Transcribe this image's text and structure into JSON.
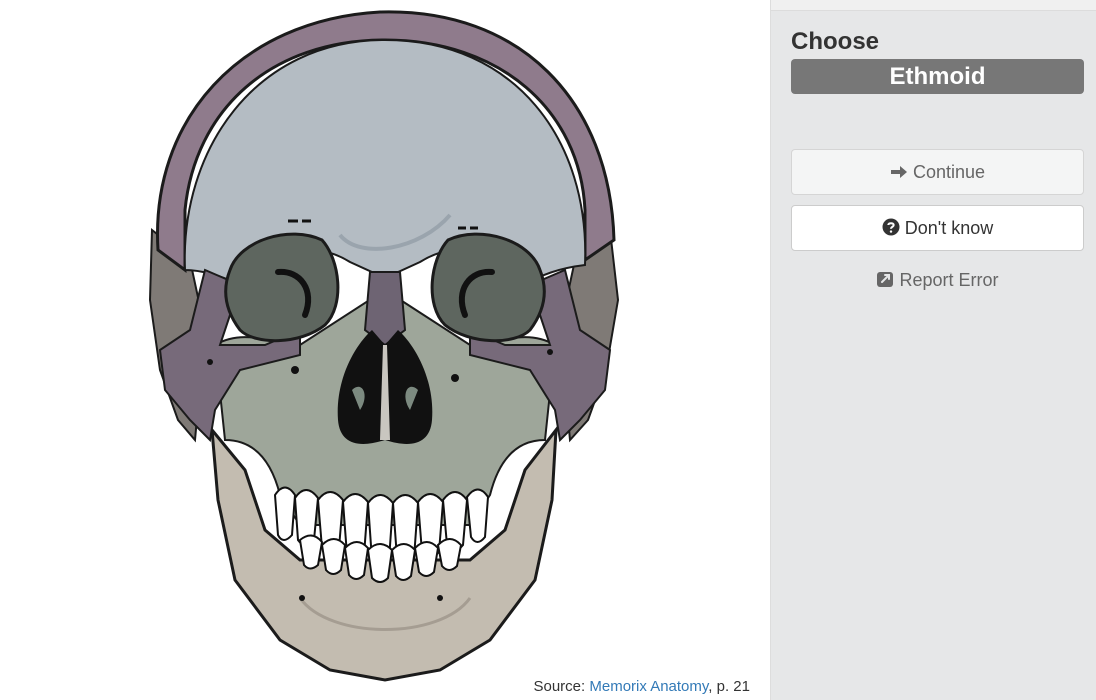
{
  "sidebar": {
    "choose_label": "Choose",
    "target_term": "Ethmoid",
    "continue_label": "Continue",
    "dont_know_label": "Don't know",
    "report_error_label": "Report Error"
  },
  "source": {
    "prefix": "Source: ",
    "link_text": "Memorix Anatomy",
    "suffix": ", p. 21"
  },
  "icons": {
    "continue": "arrow-right-icon",
    "dont_know": "question-circle-icon",
    "report_error": "external-link-icon"
  },
  "colors": {
    "badge": "#777777",
    "link": "#337ab7",
    "sidebar_bg": "#e6e7e8",
    "frontal_bone": "#b4bcc3",
    "parietal_bone": "#8e7a8a",
    "maxilla": "#9ea69a",
    "mandible": "#c3bcb0",
    "zygomatic": "#776a7a"
  }
}
